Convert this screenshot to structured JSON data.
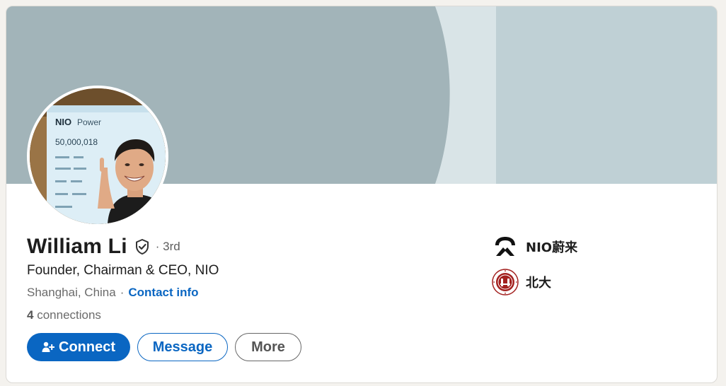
{
  "profile": {
    "name": "William Li",
    "degree": "· 3rd",
    "headline": "Founder, Chairman & CEO, NIO",
    "location": "Shanghai, China",
    "separator": "·",
    "contact_link": "Contact info",
    "connections_count": "4",
    "connections_label": "connections",
    "avatar_screen": {
      "brand": "NIO",
      "brand_sub": "Power",
      "big_number": "50,000,018"
    }
  },
  "actions": {
    "connect": "Connect",
    "message": "Message",
    "more": "More"
  },
  "side": [
    {
      "label": "NIO蔚来",
      "icon": "nio-logo-icon"
    },
    {
      "label": "北大",
      "icon": "pku-seal-icon"
    }
  ],
  "colors": {
    "accent": "#0a66c2",
    "banner_dark": "#a2b4b9",
    "banner_mid": "#d9e4e7",
    "banner_light": "#bfd0d5",
    "pku_red": "#a3211f"
  }
}
